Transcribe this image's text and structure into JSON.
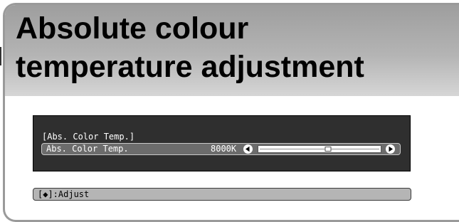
{
  "page": {
    "title_line1": "Absolute colour",
    "title_line2": "temperature adjustment"
  },
  "osd": {
    "heading": "[Abs. Color Temp.]",
    "row_label": "Abs. Color Temp.",
    "row_value": "8000K",
    "slider_position": 0.57,
    "left_icon": "left-arrow-circle-icon",
    "right_icon": "right-arrow-circle-icon"
  },
  "hint": {
    "text": "[◆]:Adjust"
  },
  "colors": {
    "title_band": "#b4b4b4",
    "osd_background": "#2f2f2f",
    "selected_row": "#6c6c6c",
    "hint_bar": "#b5b5b5"
  }
}
